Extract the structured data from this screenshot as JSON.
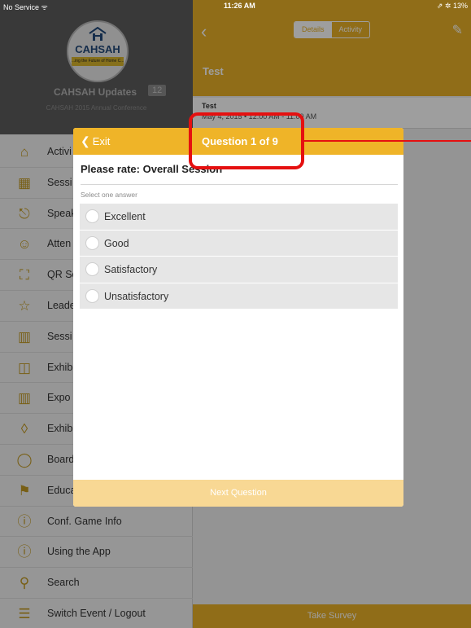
{
  "status_bar": {
    "carrier": "No Service ᯤ",
    "time": "11:26 AM",
    "battery": "⇗ ✲ 13%"
  },
  "sidebar": {
    "logo_text": "CAHSAH",
    "logo_tagline": "...ing the Future of Home C...",
    "title": "CAHSAH Updates",
    "badge": "12",
    "subtitle": "CAHSAH 2015 Annual Conference",
    "items": [
      {
        "label": "Activi",
        "icon": "home-icon"
      },
      {
        "label": "Sessi",
        "icon": "calendar-icon"
      },
      {
        "label": "Speak",
        "icon": "microphone-icon"
      },
      {
        "label": "Atten",
        "icon": "people-icon"
      },
      {
        "label": "QR Sc",
        "icon": "qr-scan-icon"
      },
      {
        "label": "Leade",
        "icon": "trophy-icon"
      },
      {
        "label": "Sessi",
        "icon": "map-icon"
      },
      {
        "label": "Exhib",
        "icon": "id-card-icon"
      },
      {
        "label": "Expo",
        "icon": "map-icon"
      },
      {
        "label": "Exhib",
        "icon": "tag-icon"
      },
      {
        "label": "Board",
        "icon": "shield-icon"
      },
      {
        "label": "Educa",
        "icon": "megaphone-icon"
      },
      {
        "label": "Conf. Game Info",
        "icon": "info-icon"
      },
      {
        "label": "Using the App",
        "icon": "info-icon"
      },
      {
        "label": "Search",
        "icon": "search-icon"
      },
      {
        "label": "Switch Event / Logout",
        "icon": "sliders-icon"
      }
    ]
  },
  "detail": {
    "tabs": [
      "Details",
      "Activity"
    ],
    "active_tab": "Details",
    "title": "Test",
    "session_title": "Test",
    "session_time": "May 4, 2015 • 12:00 AM - 11:00 AM",
    "take_survey": "Take Survey"
  },
  "survey": {
    "exit_label": "Exit",
    "counter": "Question 1 of 9",
    "question": "Please rate: Overall Session",
    "hint": "Select one answer",
    "answers": [
      "Excellent",
      "Good",
      "Satisfactory",
      "Unsatisfactory"
    ],
    "next_label": "Next Question"
  },
  "colors": {
    "accent": "#e8b127",
    "modal_header": "#efb428",
    "callout": "#e51010"
  }
}
